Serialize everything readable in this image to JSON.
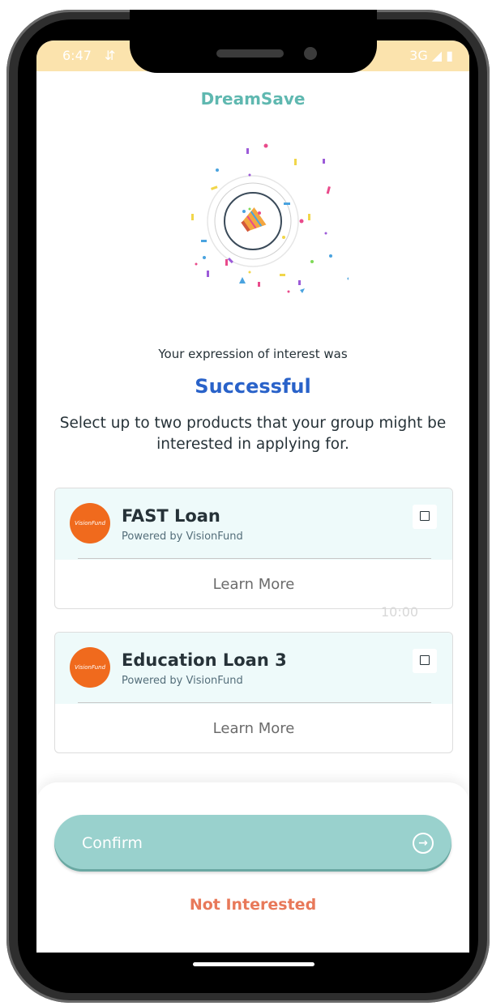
{
  "status_bar": {
    "time": "6:47",
    "sync_icon": "⇵",
    "network": "3G ◢ ▮"
  },
  "app": {
    "title": "DreamSave"
  },
  "message": {
    "line1": "Your expression of interest was",
    "result": "Successful",
    "instruction": "Select up to two products that your group might be interested in applying for."
  },
  "products": [
    {
      "name": "FAST Loan",
      "provider": "Powered by VisionFund",
      "logo_text": "VisionFund",
      "action": "Learn More",
      "checked": false
    },
    {
      "name": "Education Loan 3",
      "provider": "Powered by VisionFund",
      "logo_text": "VisionFund",
      "action": "Learn More",
      "checked": false
    }
  ],
  "ghost_text": "10:00",
  "actions": {
    "confirm": "Confirm",
    "not_interested": "Not Interested"
  },
  "colors": {
    "accent": "#5fb8b0",
    "success": "#2962c9",
    "danger": "#e8795a",
    "logo": "#f06a1d",
    "confirm_bg": "#99d1cd"
  }
}
